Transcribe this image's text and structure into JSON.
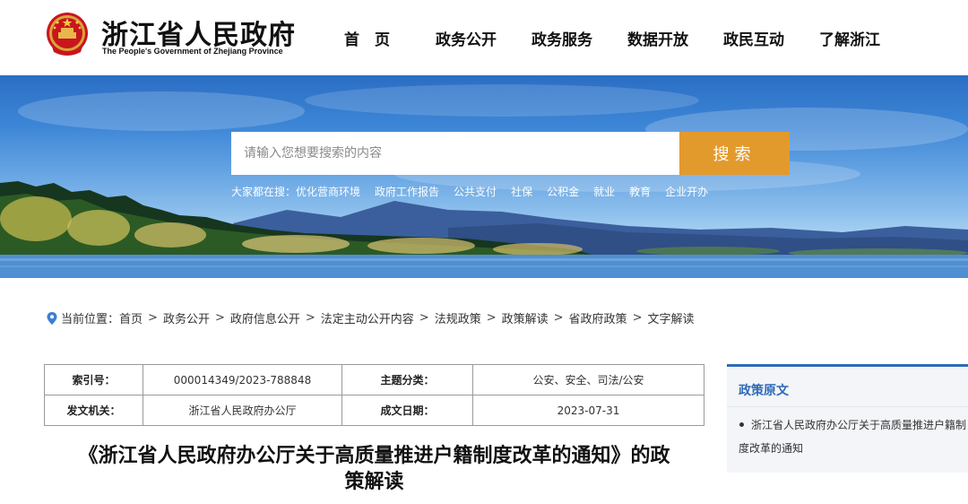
{
  "header": {
    "title": "浙江省人民政府",
    "subtitle": "The People's Government of Zhejiang Province",
    "nav": [
      {
        "label": "首　页",
        "name": "nav-home"
      },
      {
        "label": "政务公开",
        "name": "nav-open-government"
      },
      {
        "label": "政务服务",
        "name": "nav-government-services"
      },
      {
        "label": "数据开放",
        "name": "nav-open-data"
      },
      {
        "label": "政民互动",
        "name": "nav-interaction"
      },
      {
        "label": "了解浙江",
        "name": "nav-about-zhejiang"
      }
    ]
  },
  "search": {
    "placeholder": "请输入您想要搜索的内容",
    "button": "搜索",
    "hot_label": "大家都在搜：",
    "hot_items": [
      "优化营商环境",
      "政府工作报告",
      "公共支付",
      "社保",
      "公积金",
      "就业",
      "教育",
      "企业开办"
    ]
  },
  "breadcrumb": {
    "label": "当前位置：",
    "items": [
      "首页",
      "政务公开",
      "政府信息公开",
      "法定主动公开内容",
      "法规政策",
      "政策解读",
      "省政府政策",
      "文字解读"
    ]
  },
  "meta": {
    "index_label": "索引号：",
    "index_value": "000014349/2023-788848",
    "category_label": "主题分类：",
    "category_value": "公安、安全、司法/公安",
    "issuer_label": "发文机关：",
    "issuer_value": "浙江省人民政府办公厅",
    "date_label": "成文日期：",
    "date_value": "2023-07-31"
  },
  "article": {
    "title_line1": "《浙江省人民政府办公厅关于高质量推进户籍制度改革的通知》的政",
    "title_line2": "策解读"
  },
  "sidebar": {
    "title": "政策原文",
    "link": "浙江省人民政府办公厅关于高质量推进户籍制度改革的通知"
  },
  "colors": {
    "accent": "#e39a2c",
    "sidebar_accent": "#2e6bb8"
  }
}
